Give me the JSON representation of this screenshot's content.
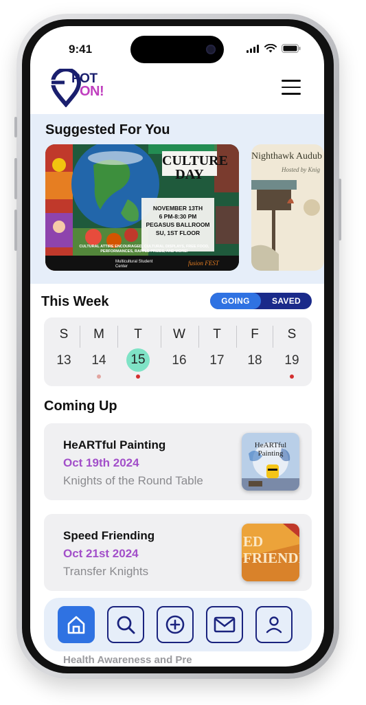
{
  "status_bar": {
    "time": "9:41"
  },
  "logo": {
    "text_top": "POT",
    "text_bottom": "ON!"
  },
  "suggested": {
    "title": "Suggested For You",
    "cards": [
      {
        "heading": "CULTURE DAY",
        "date": "NOVEMBER 13TH",
        "time": "6 PM-8:30 PM",
        "venue": "PEGASUS BALLROOM",
        "floor": "SU, 1ST FLOOR",
        "details": "CULTURAL ATTIRE ENCOURAGED, CULTURAL DISPLAYS, FREE FOOD, PERFORMANCES, RAFFLE PRIZES, AND MORE!",
        "org": "Multicultural Student Center",
        "fest": "fusion FEST"
      },
      {
        "heading": "Nighthawk Audub",
        "subheading": "Hosted by Knig"
      }
    ]
  },
  "this_week": {
    "title": "This Week",
    "toggle": {
      "going": "GOING",
      "saved": "SAVED"
    },
    "days": [
      {
        "letter": "S",
        "num": "13",
        "dot": ""
      },
      {
        "letter": "M",
        "num": "14",
        "dot": "#e2a5a0"
      },
      {
        "letter": "T",
        "num": "15",
        "dot": "#d32f2f",
        "selected": true
      },
      {
        "letter": "W",
        "num": "16",
        "dot": ""
      },
      {
        "letter": "T",
        "num": "17",
        "dot": ""
      },
      {
        "letter": "F",
        "num": "18",
        "dot": ""
      },
      {
        "letter": "S",
        "num": "19",
        "dot": "#d32f2f"
      }
    ]
  },
  "coming_up": {
    "title": "Coming Up",
    "events": [
      {
        "title": "HeARTful Painting",
        "date": "Oct 19th 2024",
        "org": "Knights of the Round Table",
        "thumb_text": "HeARTful Painting"
      },
      {
        "title": "Speed Friending",
        "date": "Oct 21st 2024",
        "org": "Transfer Knights",
        "thumb_text": "ED FRIENDI"
      }
    ],
    "peek_title": "Health Awareness and Pre"
  },
  "colors": {
    "accent": "#2f72e2",
    "navy": "#1a237e",
    "purple": "#a24fc9",
    "selected_day": "#7fe3c6"
  }
}
